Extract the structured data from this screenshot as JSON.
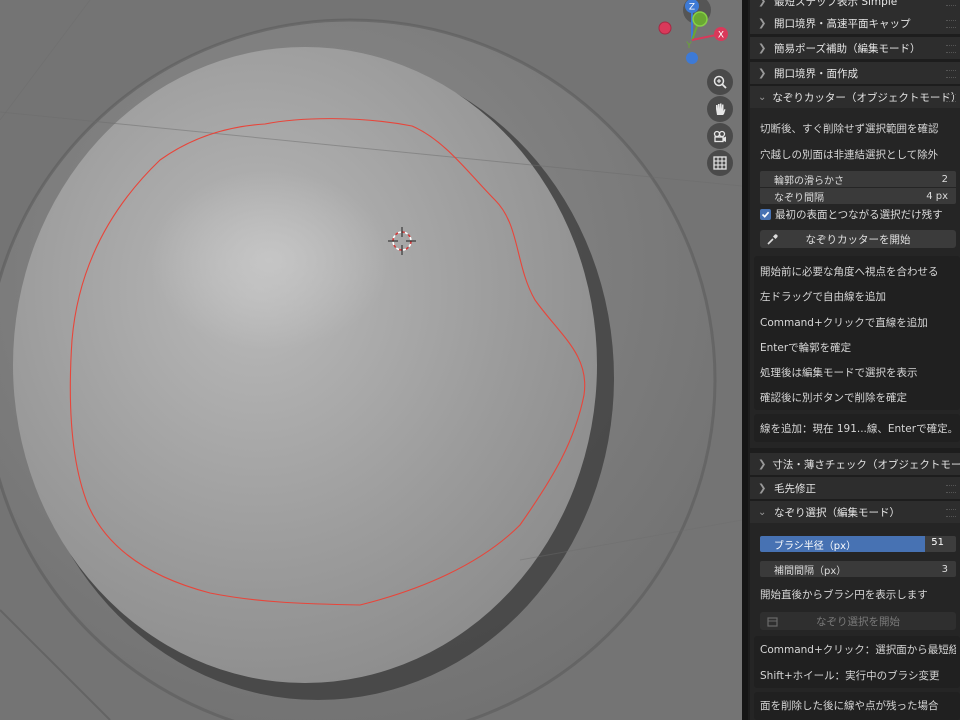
{
  "viewport": {
    "gizmo_axes": {
      "z": "Z",
      "y": "Y",
      "x": "X"
    },
    "colors": {
      "selection_outline": "#e8453a",
      "axis_x": "#d9395a",
      "axis_y": "#6aa832",
      "axis_z": "#3d7ad6"
    }
  },
  "sidebar": {
    "headers": [
      {
        "label": "最短ステップ表示 Simple",
        "expanded": false
      },
      {
        "label": "開口境界・高速平面キャップ",
        "expanded": false
      },
      {
        "label": "簡易ポーズ補助（編集モード）",
        "expanded": false
      },
      {
        "label": "開口境界・面作成",
        "expanded": false
      },
      {
        "label": "なぞりカッター（オブジェクトモード）",
        "expanded": true
      }
    ],
    "cutter": {
      "info1": "切断後、すぐ削除せず選択範囲を確認",
      "info2": "穴越しの別面は非連結選択として除外",
      "smooth_label": "輪郭の滑らかさ",
      "smooth_value": "2",
      "interval_label": "なぞり間隔",
      "interval_value": "4 px",
      "checkbox_label": "最初の表面とつながる選択だけ残す",
      "checkbox_checked": true,
      "start_button": "なぞりカッターを開始",
      "steps": [
        "開始前に必要な角度へ視点を合わせる",
        "左ドラッグで自由線を追加",
        "Command+クリックで直線を追加",
        "Enterで輪郭を確定",
        "処理後は編集モードで選択を表示",
        "確認後に別ボタンで削除を確定"
      ],
      "status": "線を追加：現在 191...線、Enterで確定。"
    },
    "headers2": [
      {
        "label": "寸法・薄さチェック（オブジェクトモード）",
        "expanded": false
      },
      {
        "label": "毛先修正",
        "expanded": false
      },
      {
        "label": "なぞり選択（編集モード）",
        "expanded": true
      }
    ],
    "select": {
      "brush_label": "ブラシ半径（px）",
      "brush_value": "51",
      "brush_fraction": 0.84,
      "interp_label": "補間間隔（px）",
      "interp_value": "3",
      "info1": "開始直後からブラシ円を表示します",
      "start_button": "なぞり選択を開始",
      "tip1": "Command+クリック：選択面から最短経路",
      "tip2": "Shift+ホイール：実行中のブラシ変更",
      "tip3": "面を削除した後に線や点が残った場合"
    }
  }
}
